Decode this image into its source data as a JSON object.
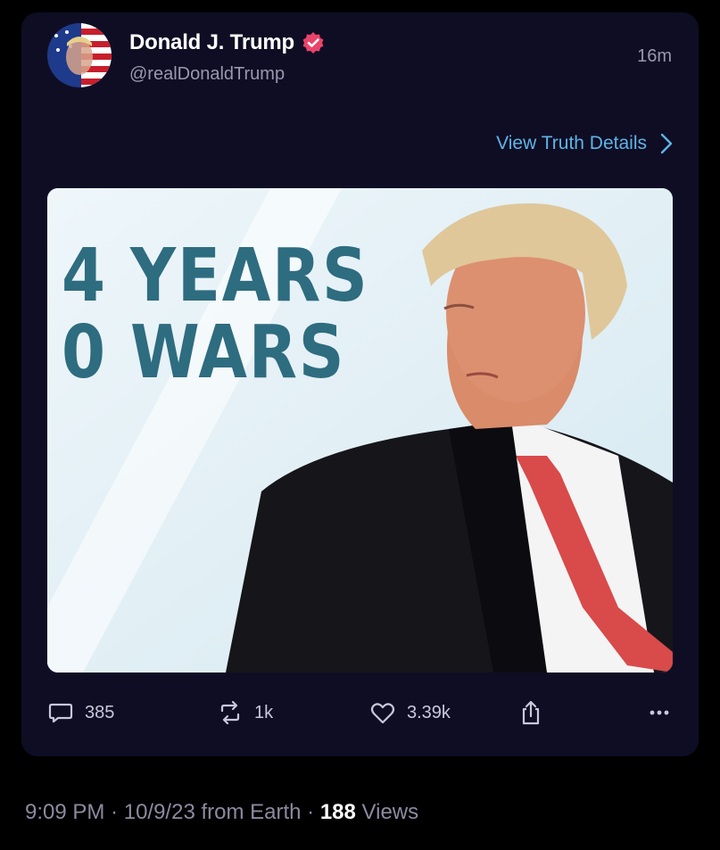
{
  "post": {
    "author_name": "Donald J. Trump",
    "handle": "@realDonaldTrump",
    "time_ago": "16m",
    "view_details_label": "View Truth Details",
    "image_text_line1": "4 YEARS",
    "image_text_line2": "0 WARS"
  },
  "actions": {
    "replies": "385",
    "retruths": "1k",
    "likes": "3.39k"
  },
  "footer": {
    "time": "9:09 PM",
    "sep1": " · ",
    "date_source": "10/9/23 from Earth",
    "sep2": " · ",
    "views_count": "188",
    "views_label": " Views"
  },
  "colors": {
    "card_bg": "#0f0d24",
    "link": "#5db5e6",
    "badge": "#e9446a",
    "headline": "#2e6c80"
  },
  "icons": [
    "avatar",
    "verified-badge-icon",
    "chevron-right-icon",
    "reply-icon",
    "retruth-icon",
    "heart-icon",
    "share-icon",
    "more-icon"
  ]
}
